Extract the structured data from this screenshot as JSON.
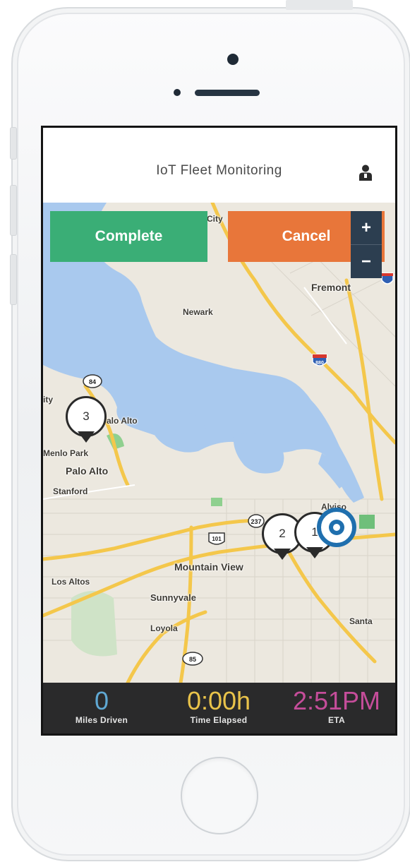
{
  "header": {
    "title": "IoT Fleet Monitoring",
    "user_icon": "user-icon"
  },
  "actions": {
    "complete_label": "Complete",
    "cancel_label": "Cancel",
    "complete_color": "#3aae76",
    "cancel_color": "#e8763a"
  },
  "zoom": {
    "in_label": "+",
    "out_label": "−"
  },
  "map": {
    "place_labels": [
      "Fremont",
      "Newark",
      "Palo Alto",
      "Menlo Park",
      "Palo Alto",
      "Stanford",
      "Alviso",
      "Mountain View",
      "Los Altos",
      "Sunnyvale",
      "Loyola",
      "Santa",
      "City",
      "City",
      "ity"
    ],
    "highway_shields": [
      "84",
      "880",
      "101",
      "237",
      "85"
    ],
    "markers": [
      "3",
      "2",
      "1"
    ]
  },
  "stats": [
    {
      "value": "0",
      "label": "Miles Driven",
      "color": "#5fa8d3"
    },
    {
      "value": "0:00h",
      "label": "Time Elapsed",
      "color": "#e9c34a"
    },
    {
      "value": "2:51PM",
      "label": "ETA",
      "color": "#c54d9a"
    }
  ]
}
